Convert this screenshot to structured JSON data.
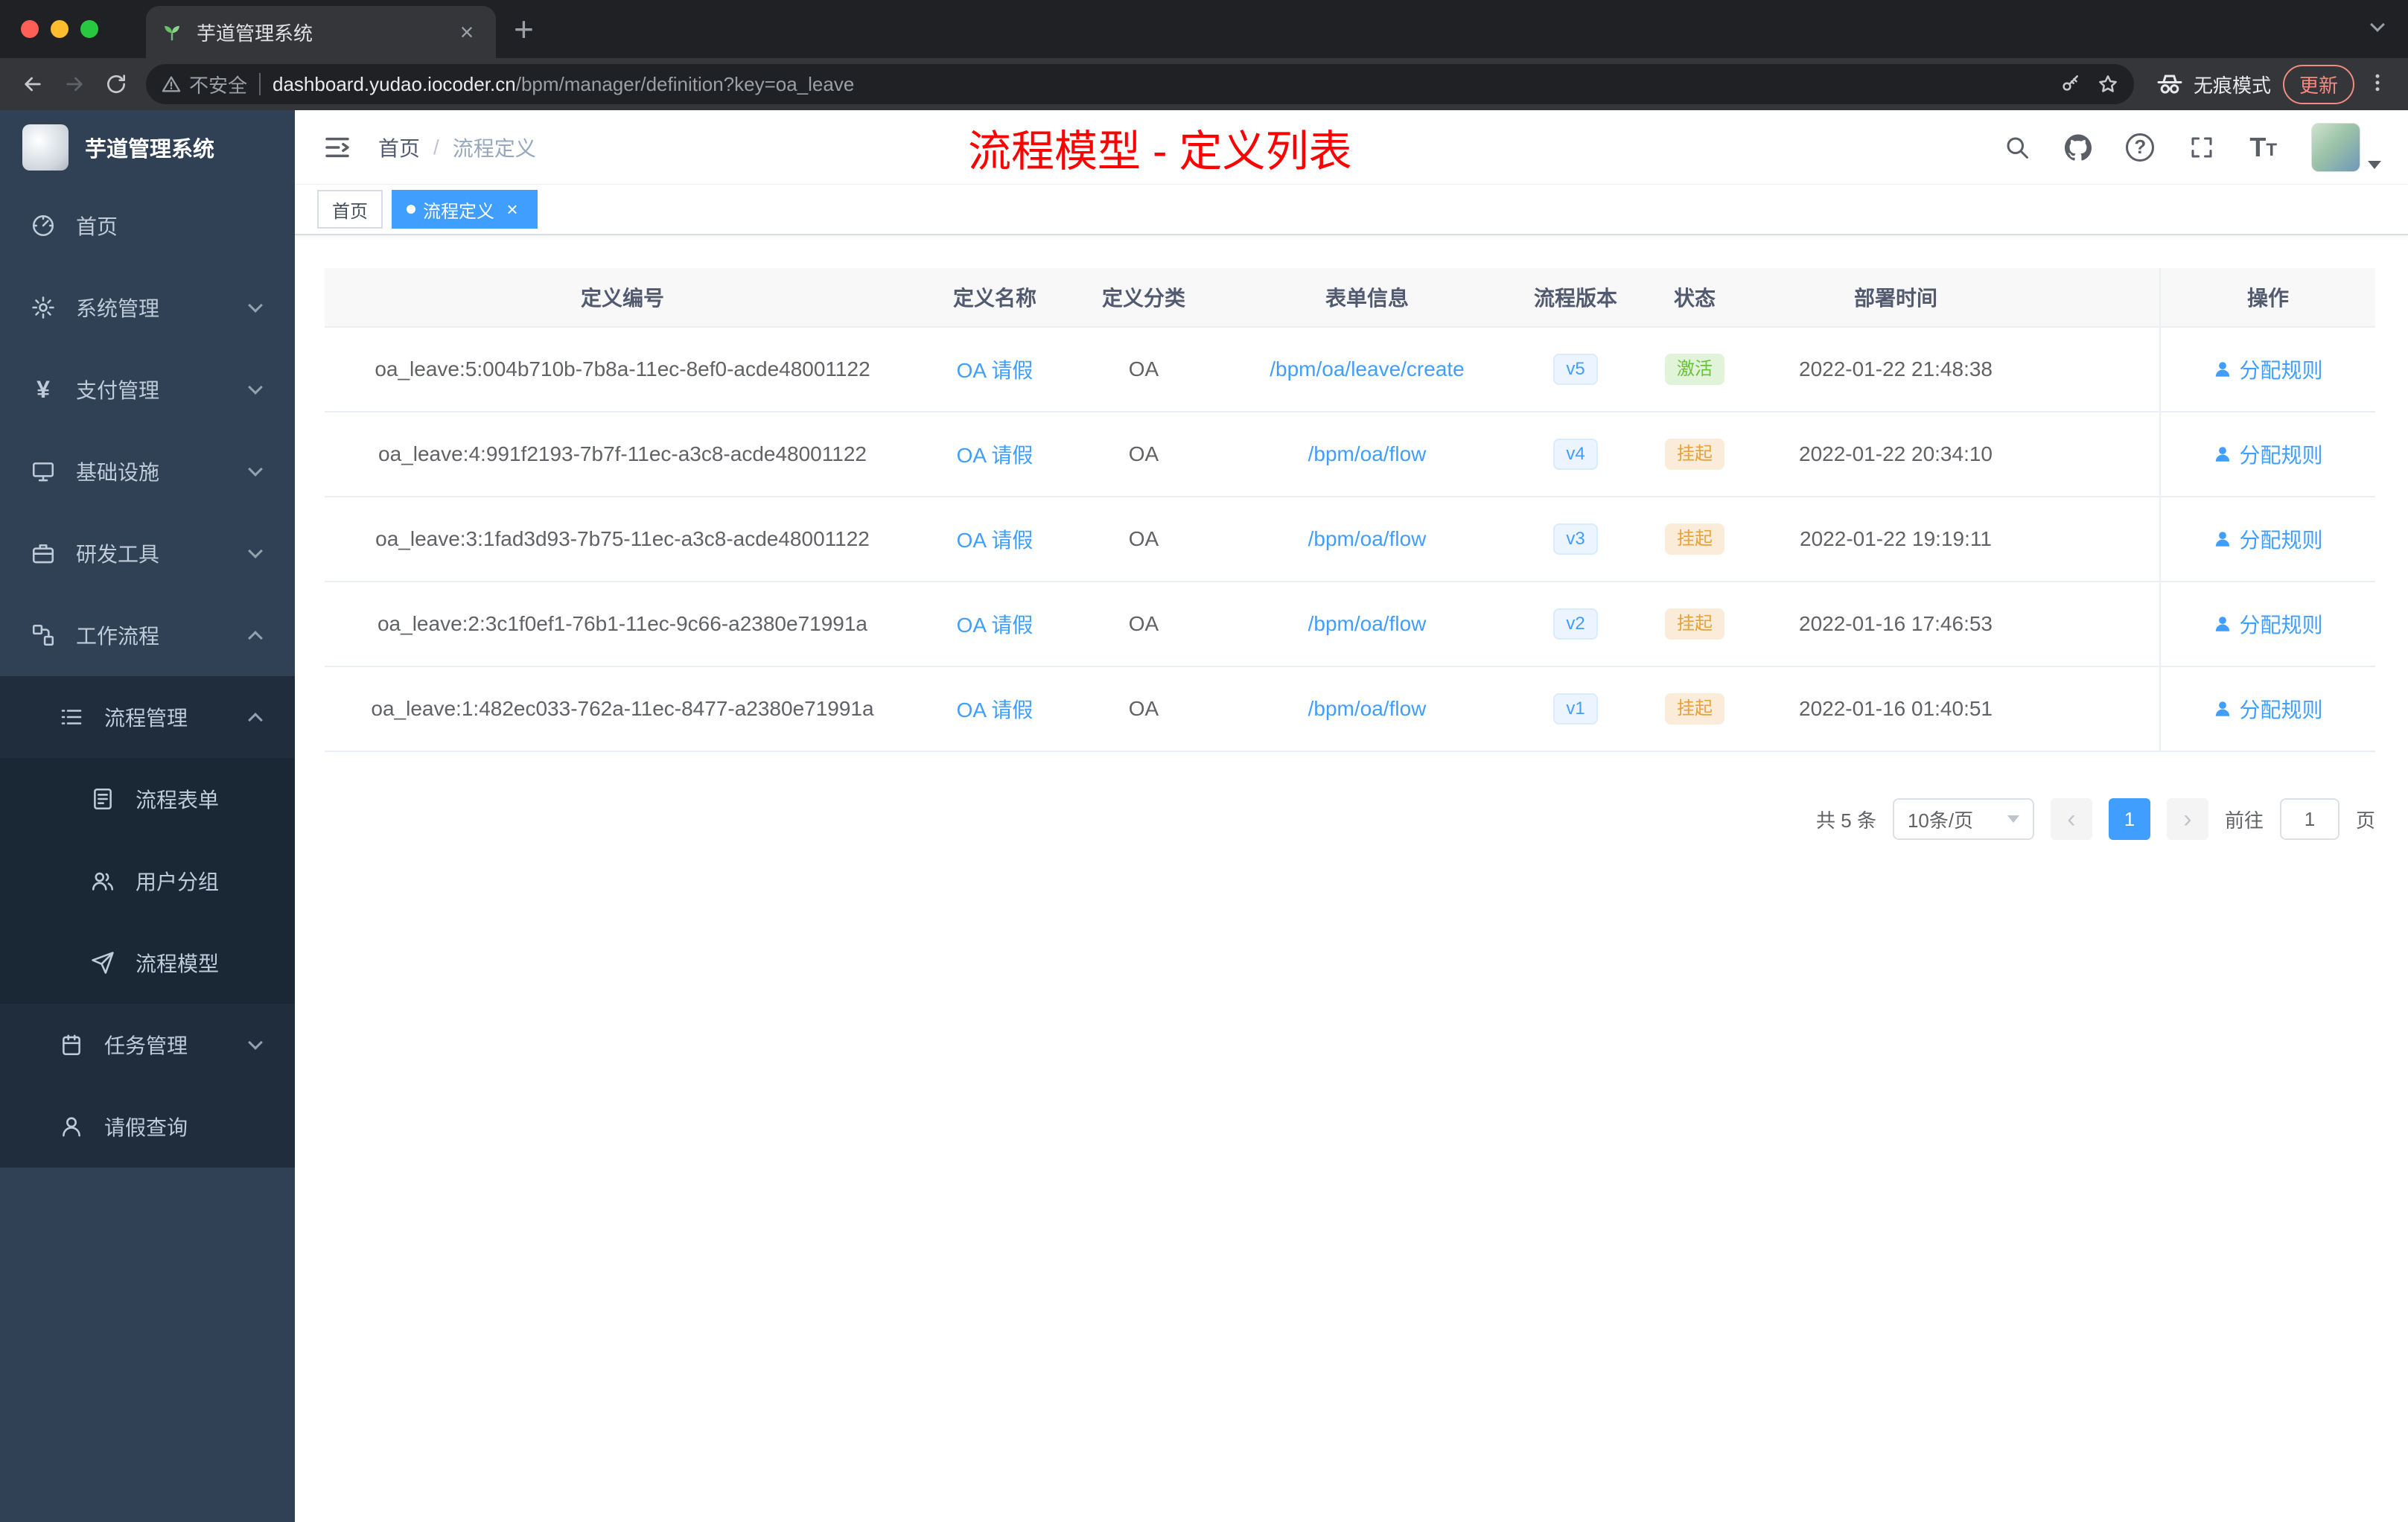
{
  "browser": {
    "tab_title": "芋道管理系统",
    "security_label": "不安全",
    "url_host": "dashboard.yudao.iocoder.cn",
    "url_path": "/bpm/manager/definition?key=oa_leave",
    "incognito_label": "无痕模式",
    "update_label": "更新"
  },
  "sidebar": {
    "logo_title": "芋道管理系统",
    "items": [
      {
        "label": "首页",
        "icon": "dashboard-icon",
        "level": 1,
        "arrow": ""
      },
      {
        "label": "系统管理",
        "icon": "gear-icon",
        "level": 1,
        "arrow": "down"
      },
      {
        "label": "支付管理",
        "icon": "yen-icon",
        "level": 1,
        "arrow": "down"
      },
      {
        "label": "基础设施",
        "icon": "monitor-icon",
        "level": 1,
        "arrow": "down"
      },
      {
        "label": "研发工具",
        "icon": "briefcase-icon",
        "level": 1,
        "arrow": "down"
      },
      {
        "label": "工作流程",
        "icon": "workflow-icon",
        "level": 1,
        "arrow": "up"
      },
      {
        "label": "流程管理",
        "icon": "list-icon",
        "level": 2,
        "arrow": "up"
      },
      {
        "label": "流程表单",
        "icon": "form-icon",
        "level": 3,
        "arrow": ""
      },
      {
        "label": "用户分组",
        "icon": "users-icon",
        "level": 3,
        "arrow": ""
      },
      {
        "label": "流程模型",
        "icon": "send-icon",
        "level": 3,
        "arrow": ""
      },
      {
        "label": "任务管理",
        "icon": "task-icon",
        "level": 2,
        "arrow": "down"
      },
      {
        "label": "请假查询",
        "icon": "person-icon",
        "level": 2,
        "arrow": ""
      }
    ]
  },
  "header": {
    "breadcrumb_home": "首页",
    "breadcrumb_sep": "/",
    "breadcrumb_current": "流程定义",
    "annotation": "流程模型 - 定义列表"
  },
  "tags": {
    "home_label": "首页",
    "active_label": "流程定义"
  },
  "table": {
    "columns": [
      "定义编号",
      "定义名称",
      "定义分类",
      "表单信息",
      "流程版本",
      "状态",
      "部署时间",
      "操作"
    ],
    "rows": [
      {
        "id": "oa_leave:5:004b710b-7b8a-11ec-8ef0-acde48001122",
        "name": "OA 请假",
        "category": "OA",
        "form": "/bpm/oa/leave/create",
        "version": "v5",
        "status": "激活",
        "status_type": "success",
        "deploy_time": "2022-01-22 21:48:38",
        "action": "分配规则"
      },
      {
        "id": "oa_leave:4:991f2193-7b7f-11ec-a3c8-acde48001122",
        "name": "OA 请假",
        "category": "OA",
        "form": "/bpm/oa/flow",
        "version": "v4",
        "status": "挂起",
        "status_type": "warning",
        "deploy_time": "2022-01-22 20:34:10",
        "action": "分配规则"
      },
      {
        "id": "oa_leave:3:1fad3d93-7b75-11ec-a3c8-acde48001122",
        "name": "OA 请假",
        "category": "OA",
        "form": "/bpm/oa/flow",
        "version": "v3",
        "status": "挂起",
        "status_type": "warning",
        "deploy_time": "2022-01-22 19:19:11",
        "action": "分配规则"
      },
      {
        "id": "oa_leave:2:3c1f0ef1-76b1-11ec-9c66-a2380e71991a",
        "name": "OA 请假",
        "category": "OA",
        "form": "/bpm/oa/flow",
        "version": "v2",
        "status": "挂起",
        "status_type": "warning",
        "deploy_time": "2022-01-16 17:46:53",
        "action": "分配规则"
      },
      {
        "id": "oa_leave:1:482ec033-762a-11ec-8477-a2380e71991a",
        "name": "OA 请假",
        "category": "OA",
        "form": "/bpm/oa/flow",
        "version": "v1",
        "status": "挂起",
        "status_type": "warning",
        "deploy_time": "2022-01-16 01:40:51",
        "action": "分配规则"
      }
    ]
  },
  "pagination": {
    "total": "共 5 条",
    "page_size": "10条/页",
    "prev": "‹",
    "next": "›",
    "current_page": "1",
    "goto_label": "前往",
    "goto_value": "1",
    "page_label": "页"
  }
}
